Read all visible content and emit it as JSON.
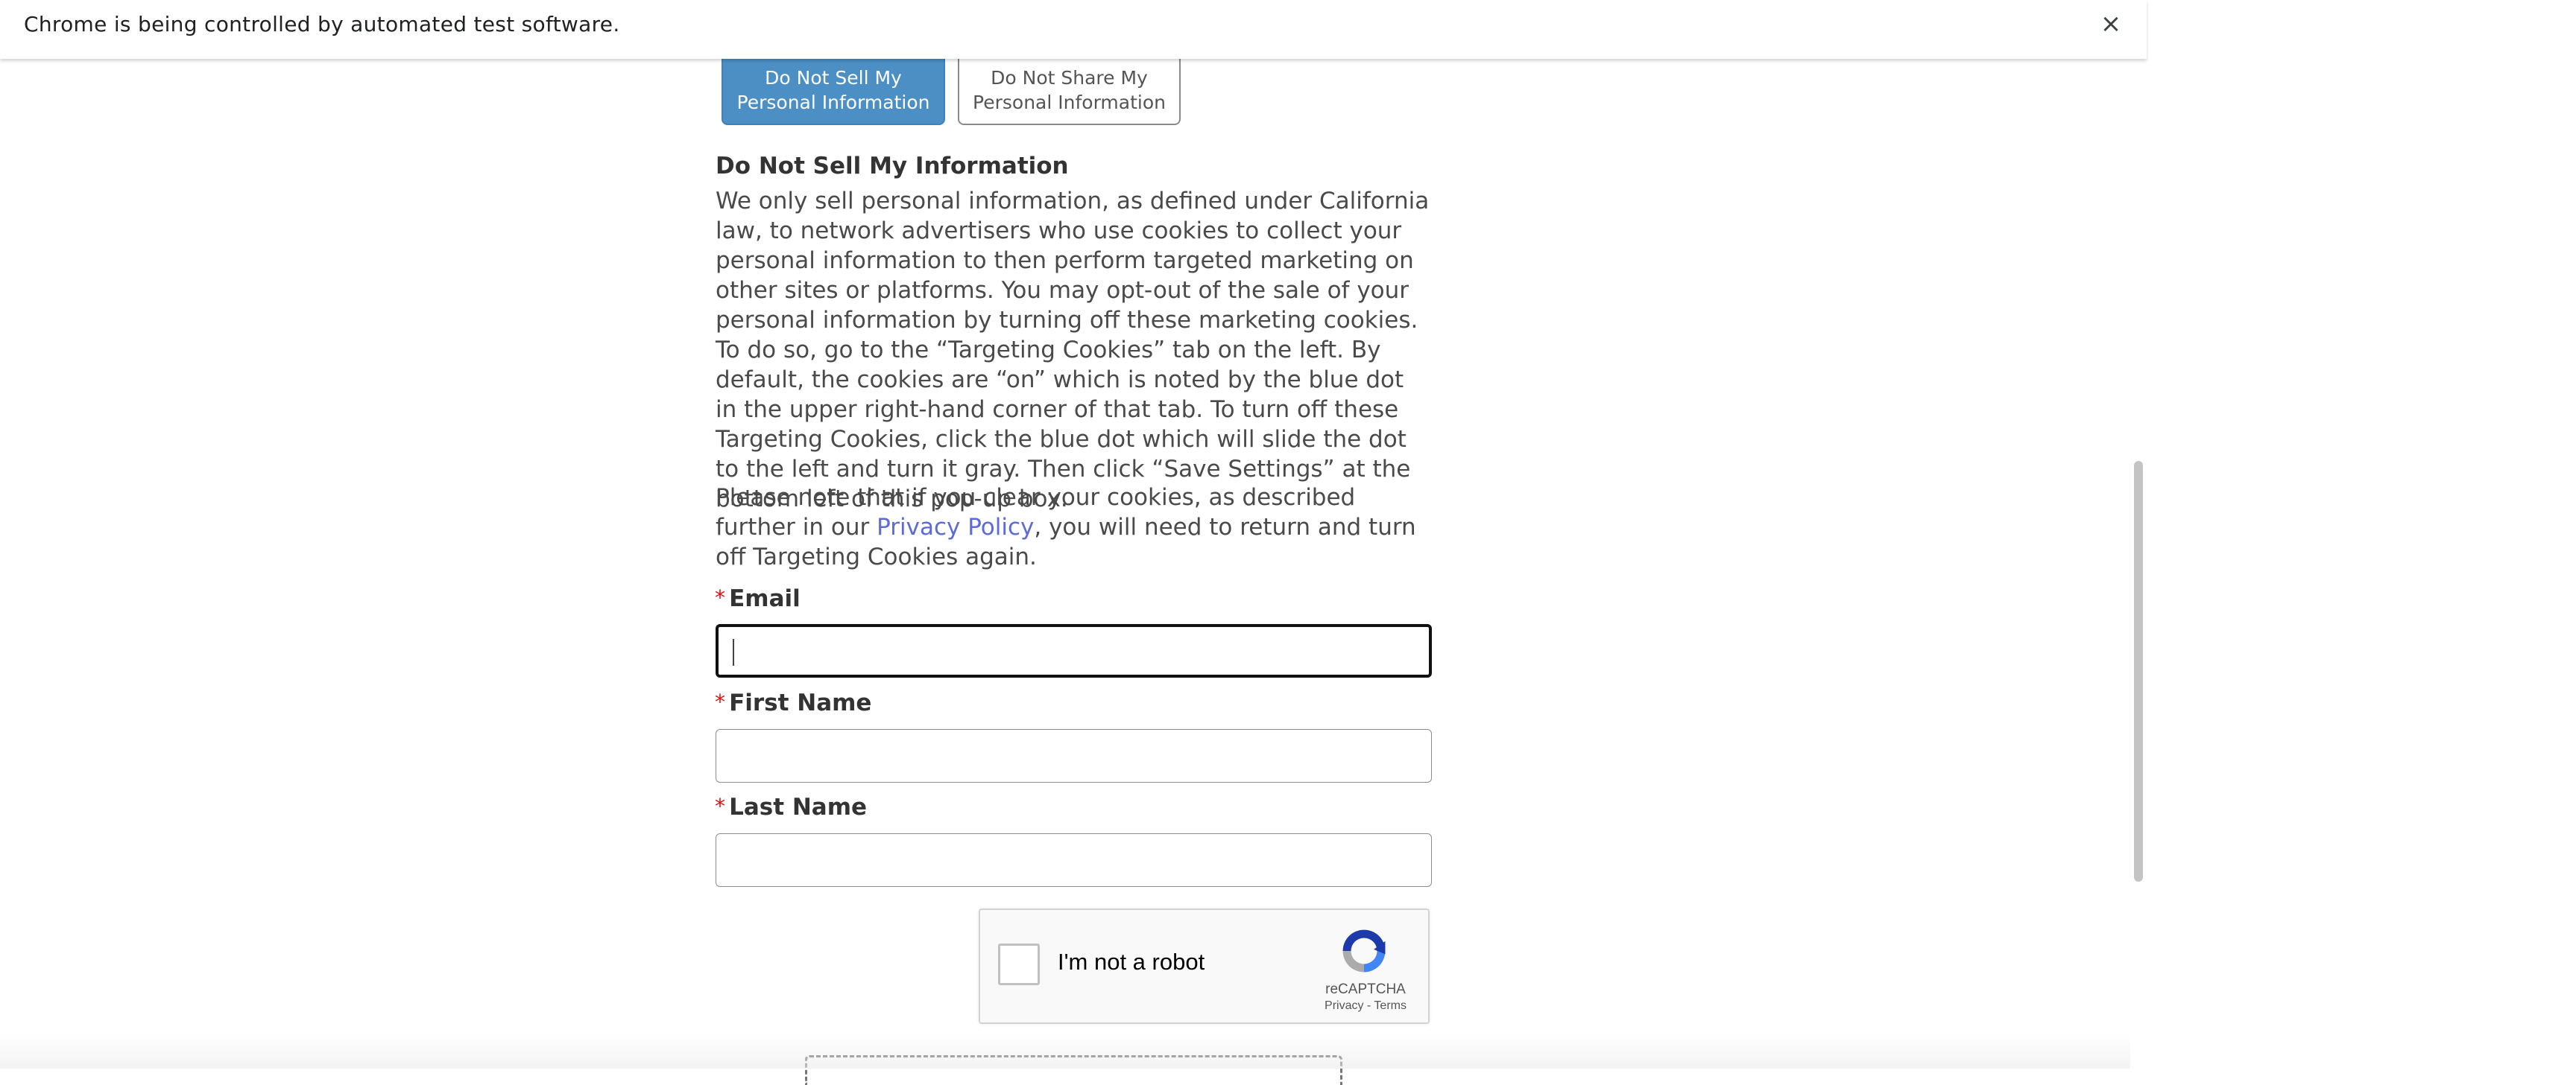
{
  "infobar": {
    "message": "Chrome is being controlled by automated test software.",
    "close_glyph": "×"
  },
  "tabs": [
    {
      "label_line1": "Do Not Sell My",
      "label_line2": "Personal Information",
      "active": true
    },
    {
      "label_line1": "Do Not Share My",
      "label_line2": "Personal Information",
      "active": false
    }
  ],
  "section": {
    "title": "Do Not Sell My Information",
    "body": "We only sell personal information, as defined under California law, to network advertisers who use cookies to collect your personal information to then perform targeted marketing on other sites or platforms. You may opt-out of the sale of your personal information by turning off these marketing cookies. To do so, go to the “Targeting Cookies” tab on the left. By default, the cookies are “on” which is noted by the blue dot in the upper right-hand corner of that tab. To turn off these Targeting Cookies, click the blue dot which will slide the dot to the left and turn it gray. Then click “Save Settings” at the bottom left of this pop-up box.",
    "note_before": "Please note that if you clear your cookies, as described further in our ",
    "note_link": "Privacy Policy",
    "note_after": ", you will need to return and turn off Targeting Cookies again."
  },
  "form": {
    "required_mark": "*",
    "email_label": "Email",
    "email_value": "",
    "first_name_label": "First Name",
    "first_name_value": "",
    "last_name_label": "Last Name",
    "last_name_value": ""
  },
  "recaptcha": {
    "label": "I'm not a robot",
    "brand": "reCAPTCHA",
    "links": "Privacy - Terms"
  },
  "colors": {
    "tab_active_bg": "#4b8fc5",
    "link": "#5c6bd7",
    "required": "#dd1111"
  }
}
